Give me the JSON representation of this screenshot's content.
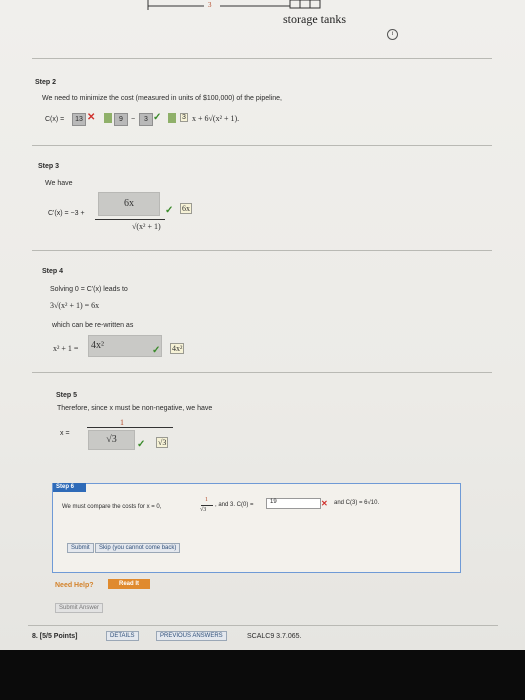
{
  "header": {
    "tick": "3",
    "title": "storage tanks",
    "info_icon": "info-circle-icon"
  },
  "step2": {
    "label": "Step 2",
    "text": "We need to minimize the cost (measured in units of $100,000) of the pipeline,",
    "lhs": "C(x) =",
    "box1": "13",
    "box2": "9",
    "minus": "−",
    "box3": "3",
    "hint": "3",
    "tail": "x + 6√(x² + 1)."
  },
  "step3": {
    "label": "Step 3",
    "text": "We have",
    "lhs": "C'(x) = −3 +",
    "numerator": "6x",
    "denominator": "√(x² + 1)",
    "hint": "6x"
  },
  "step4": {
    "label": "Step 4",
    "text": "Solving 0 = C'(x) leads to",
    "equation": "3√(x² + 1) = 6x",
    "text2": "which can be re-written as",
    "lhs": "x² + 1 =",
    "answer": "4x²",
    "hint": "4x²"
  },
  "step5": {
    "label": "Step 5",
    "text": "Therefore, since x must be non-negative, we have",
    "lhs": "x =",
    "numerator": "1",
    "answer": "√3",
    "hint": "√3"
  },
  "step6": {
    "label": "Step 6",
    "text_pre": "We must compare the costs for x = 0,",
    "frac_num": "1",
    "frac_den": "√3",
    "text_mid": ", and 3. C(0) =",
    "c0_value": "19",
    "text_post": "and C(3) = 6√10.",
    "submit": "Submit",
    "skip": "Skip (you cannot come back)"
  },
  "help": {
    "label": "Need Help?",
    "read_it": "Read It"
  },
  "submit_answer": "Submit Answer",
  "footer": {
    "points": "8. [5/5 Points]",
    "details": "DETAILS",
    "previous": "PREVIOUS ANSWERS",
    "course": "SCALC9 3.7.065."
  },
  "colors": {
    "accent": "#2f6bb8",
    "error": "#d0312d",
    "correct": "#3a8a2a",
    "help": "#d4822a"
  }
}
